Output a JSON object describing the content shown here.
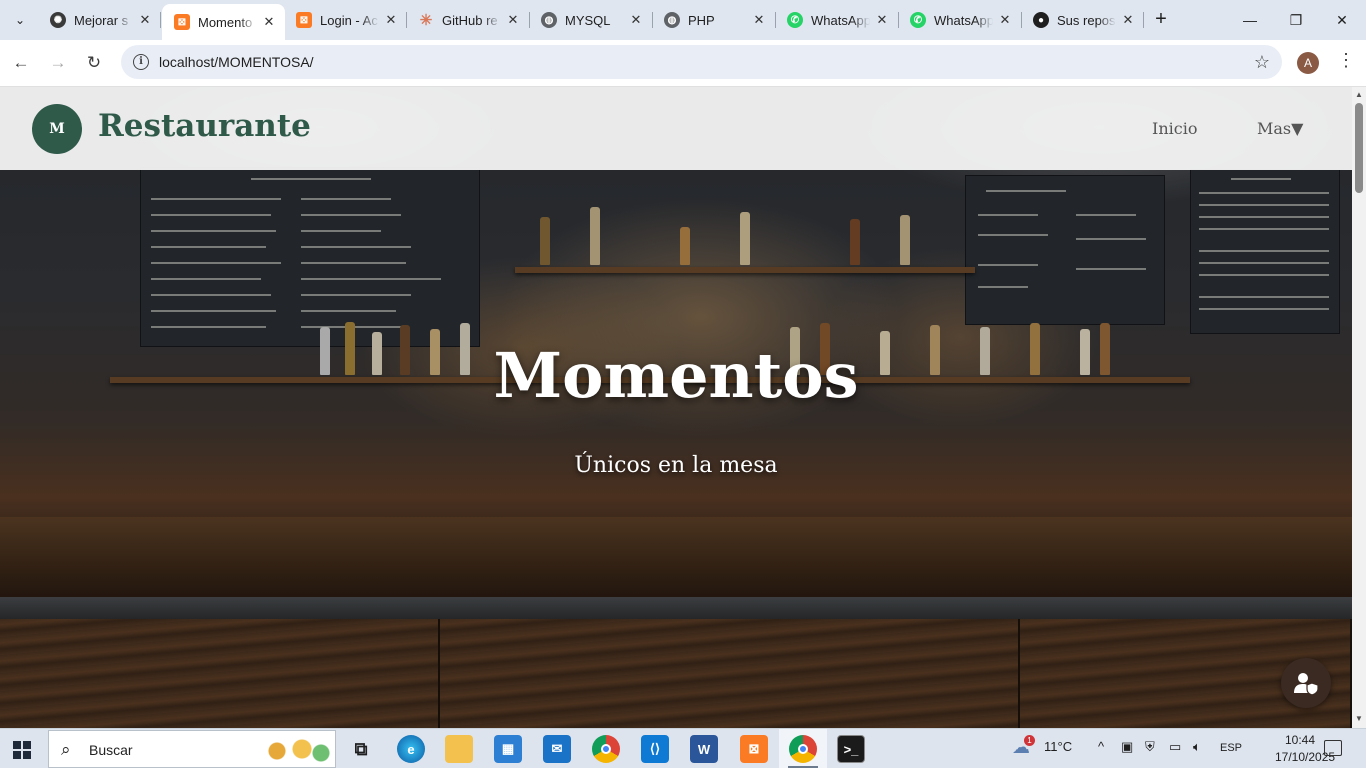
{
  "browser": {
    "tabs": [
      {
        "title": "Mejorar s",
        "favicon": "chatgpt-icon",
        "color": "#3a3a3a"
      },
      {
        "title": "Momento",
        "favicon": "xampp-icon",
        "color": "#fb7a24",
        "active": true
      },
      {
        "title": "Login - Ac",
        "favicon": "xampp-icon",
        "color": "#fb7a24"
      },
      {
        "title": "GitHub re",
        "favicon": "claude-icon",
        "color": "#d97757"
      },
      {
        "title": "MYSQL",
        "favicon": "globe-icon",
        "color": "#5f6368"
      },
      {
        "title": "PHP",
        "favicon": "globe-icon",
        "color": "#5f6368"
      },
      {
        "title": "WhatsApp",
        "favicon": "whatsapp-icon",
        "color": "#25d366"
      },
      {
        "title": "WhatsApp",
        "favicon": "whatsapp-icon",
        "color": "#25d366"
      },
      {
        "title": "Sus repos",
        "favicon": "github-icon",
        "color": "#1f1f1f"
      }
    ],
    "tab_close": "✕",
    "new_tab": "+",
    "window_controls": {
      "minimize": "—",
      "maximize": "❐",
      "close": "✕"
    },
    "url": "localhost/MOMENTOSA/",
    "profile_initial": "A"
  },
  "site": {
    "logo_text": "M",
    "brand": "Restaurante",
    "nav": {
      "home": "Inicio",
      "more": "Mas▼"
    },
    "hero_title": "Momentos",
    "hero_subtitle": "Únicos en la mesa",
    "accent_color": "#2f5a4a"
  },
  "taskbar": {
    "search_placeholder": "Buscar",
    "weather": "11°C",
    "weather_badge": "1",
    "language": "ESP",
    "time": "10:44",
    "date": "17/10/2025",
    "apps": [
      "task-view-icon",
      "edge-icon",
      "file-explorer-icon",
      "store-icon",
      "mail-icon",
      "chrome-icon",
      "vscode-icon",
      "word-icon",
      "xampp-icon",
      "chrome-profile-icon",
      "terminal-icon"
    ]
  }
}
